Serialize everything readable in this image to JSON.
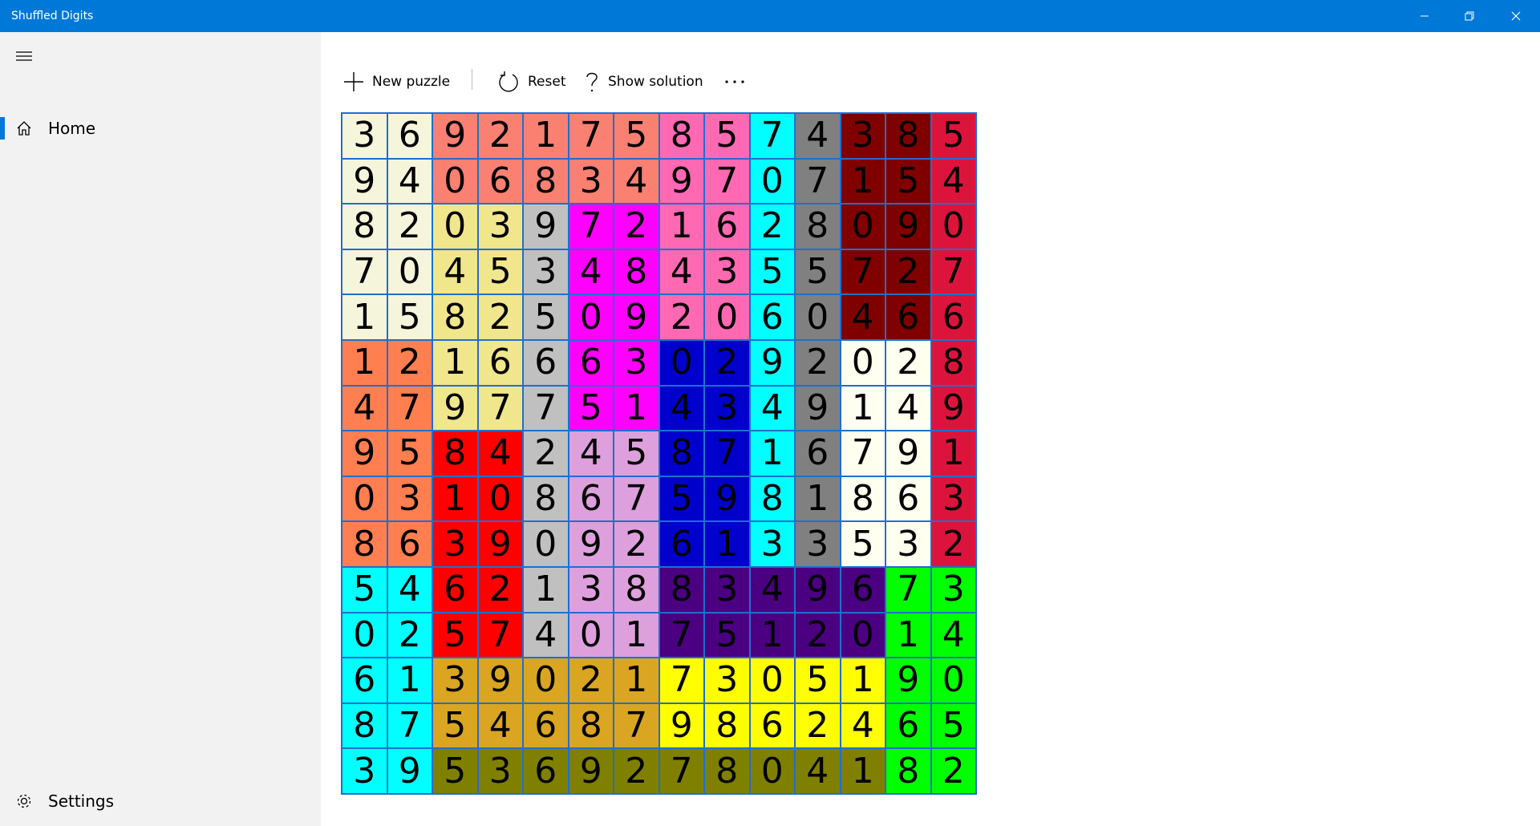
{
  "window": {
    "title": "Shuffled Digits",
    "controls": [
      "minimize-icon",
      "restore-icon",
      "close-icon"
    ]
  },
  "nav": {
    "menu_icon": "hamburger-icon",
    "home": {
      "label": "Home",
      "icon": "home-icon",
      "selected": true
    },
    "settings": {
      "label": "Settings",
      "icon": "gear-icon"
    }
  },
  "toolbar": {
    "new_puzzle": {
      "label": "New puzzle",
      "icon": "plus-icon"
    },
    "reset": {
      "label": "Reset",
      "icon": "refresh-icon"
    },
    "show_solution": {
      "label": "Show solution",
      "icon": "question-icon"
    },
    "more_icon": "more-icon"
  },
  "colors": {
    "accent": "#0078d7",
    "grid_line": "#1e6fd0",
    "palette": {
      "A": "#f5f5dc",
      "B": "#fa8072",
      "C": "#ff69b4",
      "D": "#00ffff",
      "E": "#808080",
      "F": "#800000",
      "G": "#dc143c",
      "H": "#f0e68c",
      "I": "#c0c0c0",
      "J": "#ff00ff",
      "K": "#ff7f50",
      "L": "#0000cd",
      "M": "#fffff0",
      "N": "#ff0000",
      "O": "#dda0dd",
      "P": "#4b0082",
      "Q": "#00ff00",
      "R": "#daa520",
      "S": "#ffff00",
      "T": "#808000"
    }
  },
  "puzzle": {
    "rows": [
      "36921758574385",
      "94068349707154",
      "82039721628090",
      "70453484355727",
      "15825092060466",
      "12166630292028",
      "47977514349149",
      "95842458716791",
      "03108675981863",
      "86390926133532",
      "54621388349673",
      "02574017512014",
      "61390217305190",
      "87546879862465",
      "39536927804182"
    ],
    "colors": [
      "AABBBBBCCDEFFG",
      "AABBBBBCCDEFFG",
      "AAHHIJJCCDEFFG",
      "AAHHIJJCCDEFFG",
      "AAHHIJJCCDEFFG",
      "KKHHIJJLLDEMMG",
      "KKHHIJJLLDEMMG",
      "KKNNIOOLLDEMMG",
      "KKNNIOOLLDEMMG",
      "KKNNIOOLLDEMMG",
      "DDNNIOOPPPPPQQ",
      "DDNNIOOPPPPPQQ",
      "DDRRRRRSSSSSQQ",
      "DDRRRRRSSSSSQQ",
      "DDTTTTTTTTTTQQ"
    ]
  }
}
